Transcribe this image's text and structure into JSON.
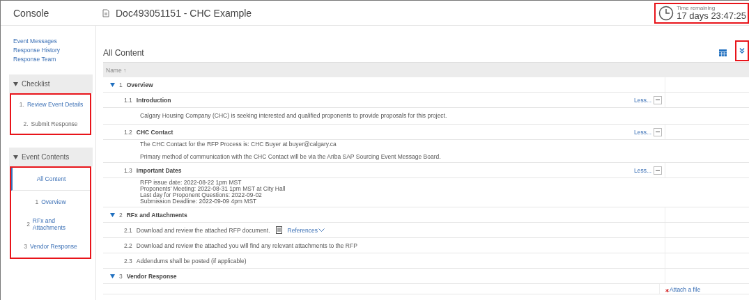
{
  "header": {
    "console": "Console",
    "title": "Doc493051151 - CHC Example",
    "timer": {
      "label": "Time remaining",
      "value": "17 days 23:47:25",
      "highlighted": true
    }
  },
  "sidebar": {
    "links": [
      "Event Messages",
      "Response History",
      "Response Team"
    ],
    "panels": [
      {
        "title": "Checklist",
        "expanded": true,
        "highlighted": true,
        "items": [
          {
            "number": "1.",
            "label": "Review Event Details",
            "selected": true
          },
          {
            "number": "2.",
            "label": "Submit Response",
            "selected": false
          }
        ]
      },
      {
        "title": "Event Contents",
        "expanded": true,
        "highlighted": true,
        "items": [
          {
            "label": "All Content",
            "selected": true
          },
          {
            "number": "1",
            "label": "Overview",
            "selected": false
          },
          {
            "number": "2",
            "label": "RFx and Attachments",
            "selected": false
          },
          {
            "number": "3",
            "label": "Vendor Response",
            "selected": false
          }
        ]
      }
    ]
  },
  "content": {
    "title": "All Content",
    "expand_all_highlighted": true,
    "column": "Name",
    "sort": "↑",
    "rows": [
      {
        "kind": "section",
        "number": "1",
        "title": "Overview",
        "expanded": true
      },
      {
        "kind": "item",
        "number": "1.1",
        "title": "Introduction",
        "toggle": "Less..."
      },
      {
        "kind": "text",
        "paragraphs": [
          [
            "Calgary Housing Company (CHC) is seeking interested and qualified proponents to provide proposals for this project."
          ]
        ]
      },
      {
        "kind": "item",
        "number": "1.2",
        "title": "CHC Contact",
        "toggle": "Less..."
      },
      {
        "kind": "text",
        "paragraphs": [
          [
            "The CHC Contact for the RFP Process is: CHC Buyer at buyer@calgary.ca"
          ],
          [
            "Primary method of communication with the CHC Contact will be via the Ariba SAP Sourcing Event Message Board."
          ]
        ]
      },
      {
        "kind": "item",
        "number": "1.3",
        "title": "Important Dates",
        "toggle": "Less..."
      },
      {
        "kind": "text",
        "paragraphs": [
          [
            "RFP issue date: 2022-08-22 1pm MST",
            "Proponents' Meeting: 2022-08-31 1pm MST at City Hall",
            "Last day for Proponent Questions: 2022-09-02",
            "Submission Deadline: 2022-09-09 4pm MST"
          ]
        ]
      },
      {
        "kind": "section",
        "number": "2",
        "title": "RFx and Attachments",
        "expanded": true
      },
      {
        "kind": "question",
        "number": "2.1",
        "title": "Download and review the attached RFP document.",
        "references": "References"
      },
      {
        "kind": "question",
        "number": "2.2",
        "title": "Download and review the attached you will find any relevant attachments to the RFP"
      },
      {
        "kind": "question",
        "number": "2.3",
        "title": "Addendums shall be posted (if applicable)"
      },
      {
        "kind": "section",
        "number": "3",
        "title": "Vendor Response",
        "expanded": true
      },
      {
        "kind": "upload",
        "required": true,
        "action": "Attach a file"
      }
    ]
  }
}
